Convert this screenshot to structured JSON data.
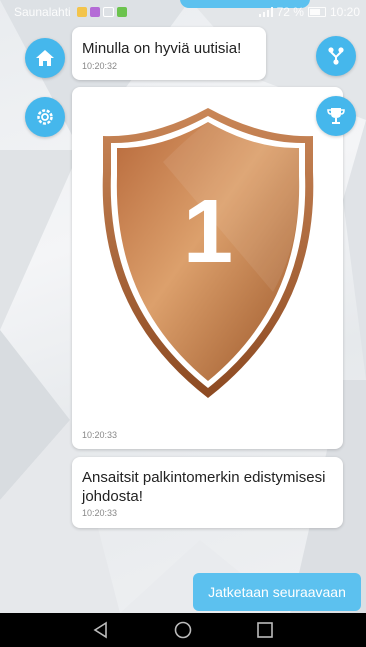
{
  "status_bar": {
    "carrier": "Saunalahti",
    "signal_battery": "72 %",
    "time": "10:20"
  },
  "chat": {
    "messages": [
      {
        "text": "Minulla on hyviä uutisia!",
        "time": "10:20:32"
      },
      {
        "badge_number": "1",
        "time": "10:20:33"
      },
      {
        "text": "Ansaitsit palkintomerkin edistymisesi johdosta!",
        "time": "10:20:33"
      }
    ],
    "continue_label": "Jatketaan seuraavaan"
  },
  "side_buttons": {
    "left": [
      "home-icon",
      "gear-icon"
    ],
    "right": [
      "branch-icon",
      "trophy-icon"
    ]
  },
  "colors": {
    "accent": "#45b7ec",
    "button": "#5cc1ef",
    "badge_bronze": "#c07a4a"
  },
  "nav_bar": [
    "back-icon",
    "home-circle-icon",
    "recents-icon"
  ]
}
